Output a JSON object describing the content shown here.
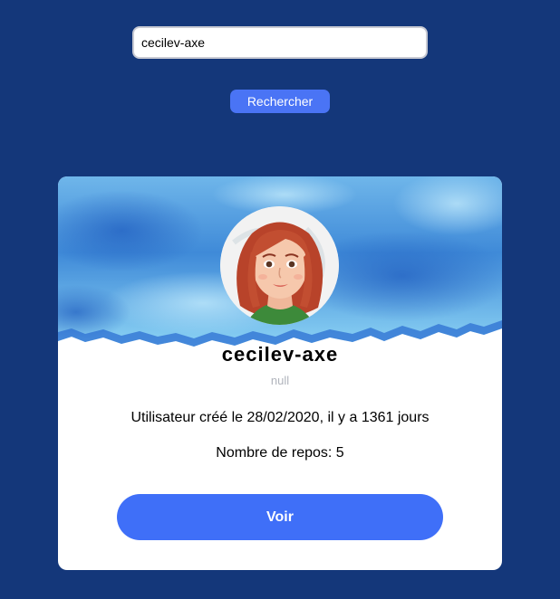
{
  "search": {
    "value": "cecilev-axe"
  },
  "search_button": {
    "label": "Rechercher"
  },
  "profile": {
    "username": "cecilev-axe",
    "bio": "null",
    "created_text": "Utilisateur créé le 28/02/2020, il y a 1361 jours",
    "repos_text": "Nombre de repos: 5",
    "view_button_label": "Voir"
  },
  "colors": {
    "background": "#14377a",
    "accent": "#3f6ff8",
    "banner_blue": "#4f9be0",
    "card": "#ffffff",
    "muted_text": "#b0b4bc"
  },
  "icons": {
    "banner": "watercolor-banner-image",
    "avatar": "avatar-illustration-red-haired-woman"
  }
}
